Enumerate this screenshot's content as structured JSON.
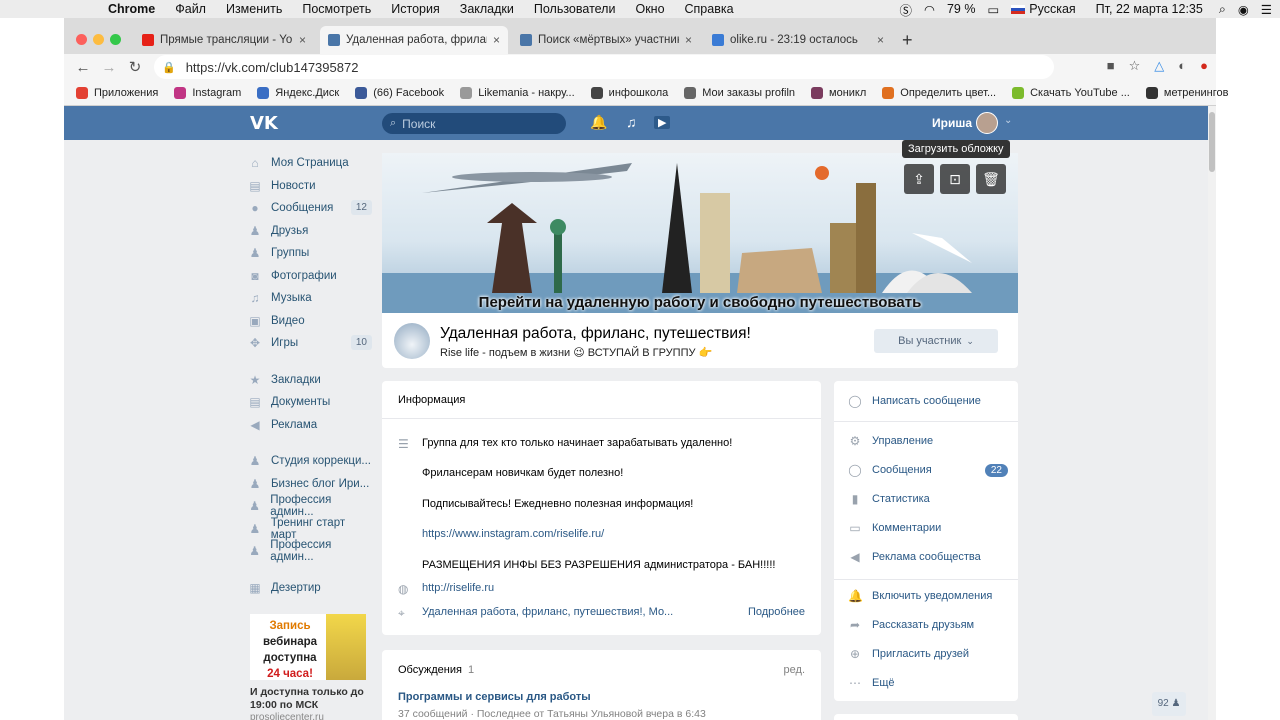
{
  "menubar": {
    "apple": "",
    "items": [
      "Chrome",
      "Файл",
      "Изменить",
      "Посмотреть",
      "История",
      "Закладки",
      "Пользователи",
      "Окно",
      "Справка"
    ],
    "battery": "79 %",
    "language": "Русская",
    "datetime": "Пт, 22 марта  12:35"
  },
  "tabs": [
    {
      "title": "Прямые трансляции - You...",
      "favicon_color": "#e62117"
    },
    {
      "title": "Удаленная работа, фриланс,",
      "favicon_color": "#4a76a8"
    },
    {
      "title": "Поиск «мёртвых» участнико",
      "favicon_color": "#4a76a8"
    },
    {
      "title": "olike.ru - 23:19 осталось",
      "favicon_color": "#3a7bd5"
    }
  ],
  "address": {
    "url": "https://vk.com/club147395872"
  },
  "bookmarks": [
    {
      "label": "Приложения",
      "color": "#e34133"
    },
    {
      "label": "Instagram",
      "color": "#c13584"
    },
    {
      "label": "Яндекс.Диск",
      "color": "#3a6ec4"
    },
    {
      "label": "(66) Facebook",
      "color": "#3b5998"
    },
    {
      "label": "Likemania - накру...",
      "color": "#999999"
    },
    {
      "label": "инфошкола",
      "color": "#444444"
    },
    {
      "label": "Мои заказы profiln",
      "color": "#666666"
    },
    {
      "label": "моникл",
      "color": "#7a3b5e"
    },
    {
      "label": "Определить цвет...",
      "color": "#e07020"
    },
    {
      "label": "Скачать YouTube ...",
      "color": "#7cbb2c"
    },
    {
      "label": "метренингов",
      "color": "#333333"
    }
  ],
  "vk": {
    "search_placeholder": "Поиск",
    "user_name": "Ириша"
  },
  "leftmenu": [
    {
      "label": "Моя Страница",
      "icon": "home-icon",
      "glyph": "⌂"
    },
    {
      "label": "Новости",
      "icon": "news-icon",
      "glyph": "▤"
    },
    {
      "label": "Сообщения",
      "icon": "messages-icon",
      "glyph": "●",
      "count": "12"
    },
    {
      "label": "Друзья",
      "icon": "friends-icon",
      "glyph": "♟"
    },
    {
      "label": "Группы",
      "icon": "groups-icon",
      "glyph": "♟"
    },
    {
      "label": "Фотографии",
      "icon": "photos-icon",
      "glyph": "◙"
    },
    {
      "label": "Музыка",
      "icon": "music-icon",
      "glyph": "♫"
    },
    {
      "label": "Видео",
      "icon": "video-icon",
      "glyph": "▣"
    },
    {
      "label": "Игры",
      "icon": "games-icon",
      "glyph": "✥",
      "count": "10"
    }
  ],
  "leftmenu2": [
    {
      "label": "Закладки",
      "icon": "bookmarks-icon",
      "glyph": "★"
    },
    {
      "label": "Документы",
      "icon": "documents-icon",
      "glyph": "▤"
    },
    {
      "label": "Реклама",
      "icon": "ads-icon",
      "glyph": "◀"
    }
  ],
  "leftmenu3": [
    {
      "label": "Студия коррекци...",
      "icon": "group-icon",
      "glyph": "♟"
    },
    {
      "label": "Бизнес блог Ири...",
      "icon": "group-icon",
      "glyph": "♟"
    },
    {
      "label": "Профессия админ...",
      "icon": "group-icon",
      "glyph": "♟"
    },
    {
      "label": "Тренинг старт март",
      "icon": "group-icon",
      "glyph": "♟"
    },
    {
      "label": "Профессия админ...",
      "icon": "group-icon",
      "glyph": "♟"
    }
  ],
  "leftmenu4": [
    {
      "label": "Дезертир",
      "icon": "app-icon",
      "glyph": "▦"
    }
  ],
  "promo": {
    "line1": "Запись",
    "line2": "вебинара",
    "line3": "доступна",
    "line4": "24 часа!",
    "caption": "И доступна только до 19:00 по МСК",
    "source": "prosoliecenter.ru"
  },
  "cover": {
    "title": "Перейти на удаленную работу и свободно путешествовать",
    "tooltip": "Загрузить обложку",
    "btn_upload": "⇪",
    "btn_crop": "⊡",
    "btn_delete": "🗑"
  },
  "group": {
    "name": "Удаленная работа, фриланс, путешествия!",
    "status": "Rise life - подъем в жизни 😉 ВСТУПАЙ В ГРУППУ 👉",
    "member_button": "Вы участник"
  },
  "info": {
    "header": "Информация",
    "description": [
      "Группа для тех кто только начинает зарабатывать удаленно!",
      "Фрилансерам новичкам будет полезно!",
      "Подписывайтесь! Ежедневно полезная информация!",
      "https://www.instagram.com/riselife.ru/",
      "РАЗМЕЩЕНИЯ ИНФЫ БЕЗ РАЗРЕШЕНИЯ администратора - БАН!!!!!"
    ],
    "site": "http://riselife.ru",
    "place": "Удаленная работа, фриланс, путешествия!, Мо...",
    "more": "Подробнее"
  },
  "discussions": {
    "header": "Обсуждения",
    "count": "1",
    "edit": "ред.",
    "topic": "Программы и сервисы для работы",
    "meta": "37 сообщений  ·  Последнее от Татьяны Ульяновой вчера в 6:43"
  },
  "actions": {
    "write": "Написать сообщение",
    "items": [
      {
        "label": "Управление",
        "icon": "settings-icon",
        "glyph": "⚙"
      },
      {
        "label": "Сообщения",
        "icon": "messages-icon",
        "glyph": "◯",
        "badge": "22"
      },
      {
        "label": "Статистика",
        "icon": "stats-icon",
        "glyph": "▮"
      },
      {
        "label": "Комментарии",
        "icon": "comments-icon",
        "glyph": "▭"
      },
      {
        "label": "Реклама сообщества",
        "icon": "ads-icon",
        "glyph": "◀"
      }
    ],
    "items2": [
      {
        "label": "Включить уведомления",
        "icon": "bell-icon",
        "glyph": "🔔"
      },
      {
        "label": "Рассказать друзьям",
        "icon": "share-icon",
        "glyph": "➦"
      },
      {
        "label": "Пригласить друзей",
        "icon": "invite-icon",
        "glyph": "⊕"
      },
      {
        "label": "Ещё",
        "icon": "more-icon",
        "glyph": "⋯"
      }
    ]
  },
  "online_counter": "92"
}
